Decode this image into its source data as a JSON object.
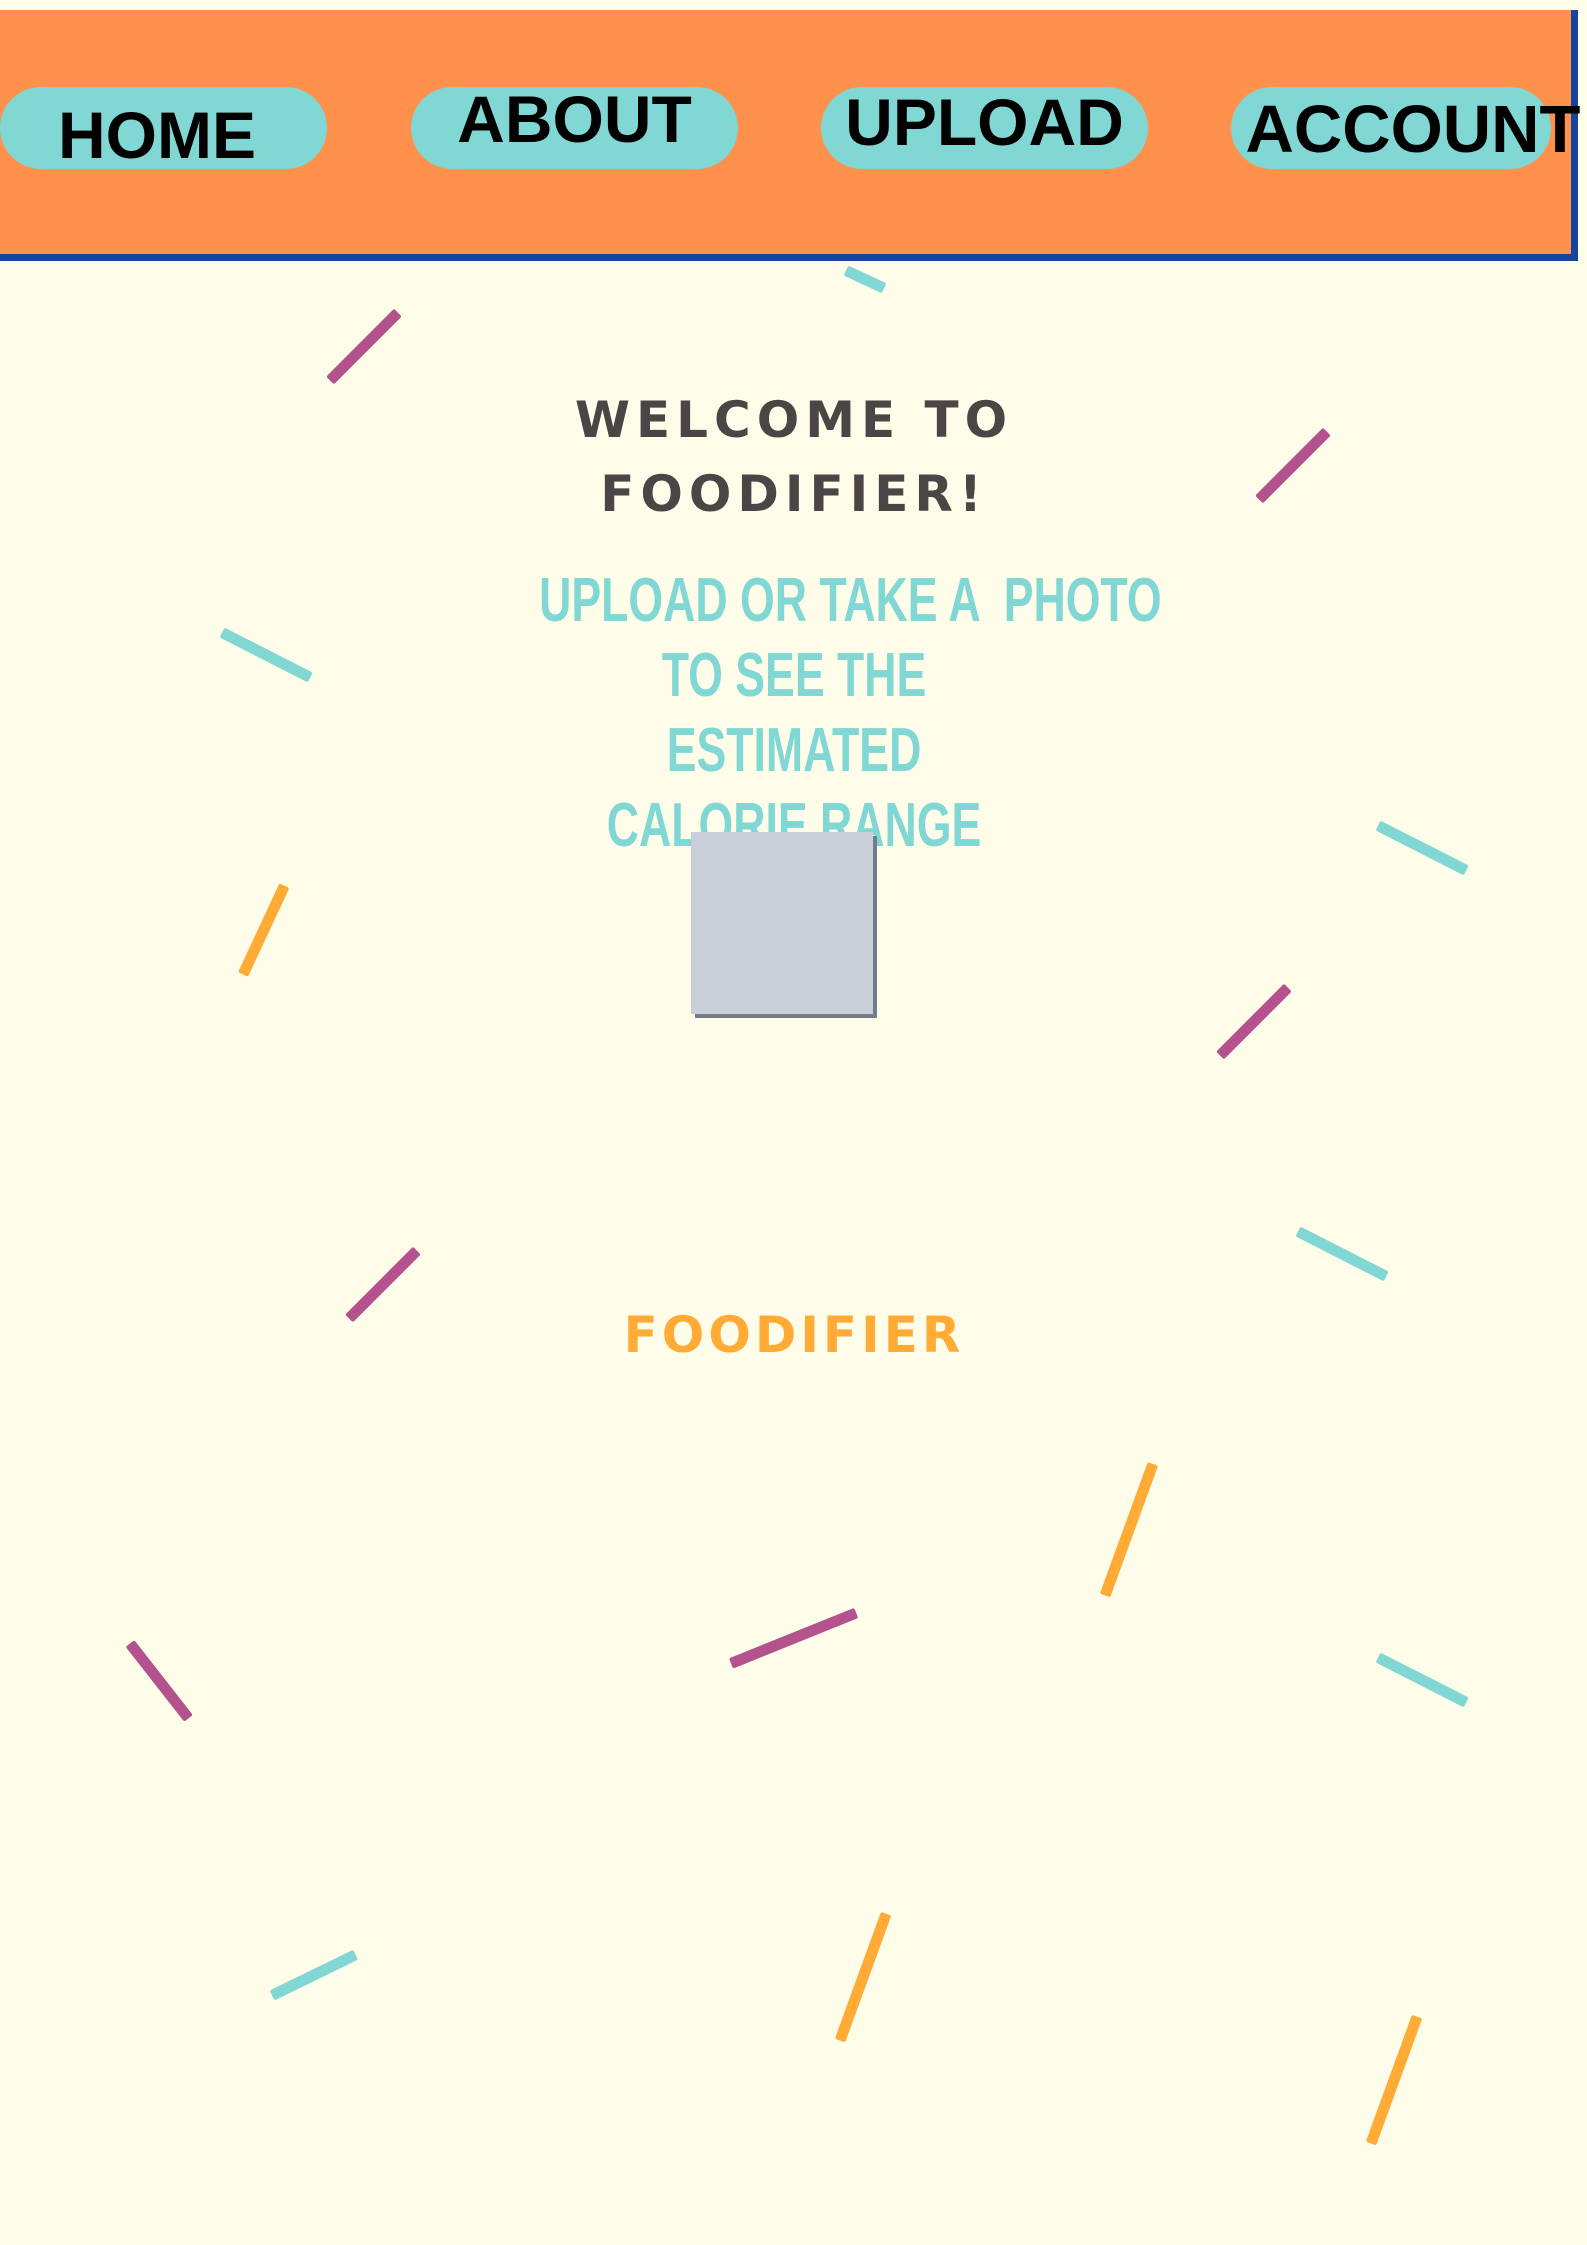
{
  "nav": {
    "home_label": "HOME",
    "about_label": "ABOUT",
    "upload_label": "UPLOAD",
    "account_label": "ACCOUNT"
  },
  "main": {
    "welcome_line1": "WELCOME TO",
    "welcome_line2": "FOODIFIER!",
    "instructions_line1": "UPLOAD OR TAKE A  PHOTO",
    "instructions_line2": "TO SEE THE ESTIMATED",
    "instructions_line3": "CALORIE RANGE",
    "brand": "FOODIFIER"
  },
  "colors": {
    "background": "#fefde9",
    "nav_background": "#ff914d",
    "nav_border": "#1645a1",
    "nav_button": "#80d7d3",
    "heading_text": "#4a4646",
    "accent_cyan": "#80d7d3",
    "accent_orange": "#ffab36",
    "accent_purple": "#b4528e",
    "upload_placeholder": "#c8cfd8"
  }
}
